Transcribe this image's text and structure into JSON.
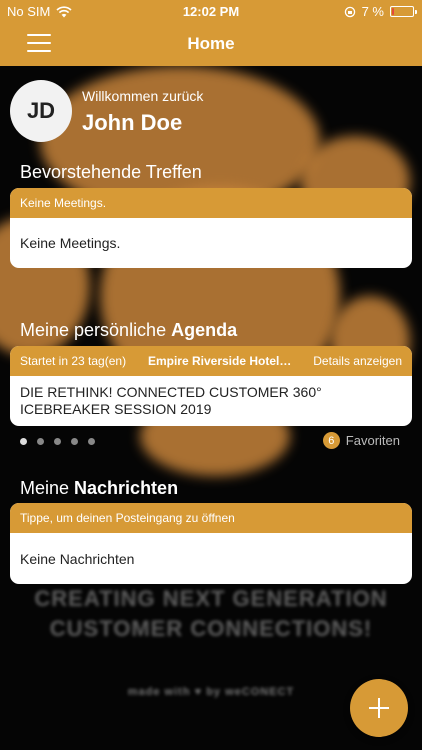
{
  "status_bar": {
    "carrier": "No SIM",
    "time": "12:02 PM",
    "battery_text": "7 %",
    "battery_level": 0.07,
    "icons": [
      "wifi-icon",
      "orientation-lock-icon",
      "battery-icon"
    ]
  },
  "nav": {
    "title": "Home",
    "menu_icon": "hamburger-icon"
  },
  "user": {
    "initials": "JD",
    "welcome": "Willkommen zurück",
    "name": "John Doe"
  },
  "meetings": {
    "title": "Bevorstehende Treffen",
    "header": "Keine Meetings.",
    "body": "Keine Meetings."
  },
  "agenda": {
    "title_prefix": "Meine persönliche ",
    "title_bold": "Agenda",
    "starts_in": "Startet in 23 tag(en)",
    "location": "Empire Riverside Hotel…",
    "details": "Details anzeigen",
    "event": "DIE RETHINK! CONNECTED CUSTOMER 360° ICEBREAKER SESSION 2019",
    "pages": 5,
    "active_page": 0,
    "favorites_count": "6",
    "favorites_label": "Favoriten"
  },
  "messages": {
    "title_prefix": "Meine ",
    "title_bold": "Nachrichten",
    "header": "Tippe, um deinen Posteingang zu öffnen",
    "body": "Keine Nachrichten"
  },
  "fab": {
    "icon": "plus-icon"
  },
  "colors": {
    "accent": "#d79a36",
    "battery_low": "#e4493a",
    "background": "#0b0b0b"
  }
}
